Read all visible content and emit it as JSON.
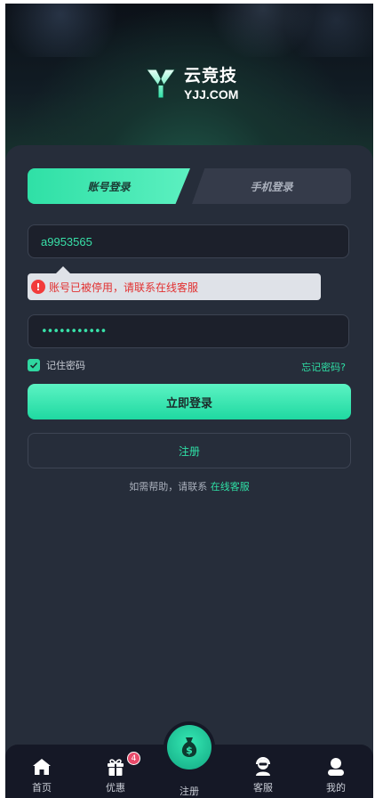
{
  "brand": {
    "name_cn": "云竞技",
    "name_en": "YJJ.COM"
  },
  "tabs": [
    {
      "label": "账号登录",
      "active": true
    },
    {
      "label": "手机登录",
      "active": false
    }
  ],
  "form": {
    "username_value": "a9953565",
    "password_mask": "•••••••••••",
    "error_message": "账号已被停用，请联系在线客服",
    "remember_label": "记住密码",
    "remember_checked": true,
    "forgot_label": "忘记密码?",
    "login_label": "立即登录",
    "register_label": "注册"
  },
  "help": {
    "text": "如需帮助，请联系",
    "link": "在线客服"
  },
  "bottom_nav": {
    "home": "首页",
    "promo": "优惠",
    "promo_badge": "4",
    "register": "注册",
    "service": "客服",
    "mine": "我的"
  },
  "colors": {
    "accent": "#2fe0a6",
    "background": "#262d3a",
    "error": "#e23030",
    "badge": "#e84a6a"
  }
}
